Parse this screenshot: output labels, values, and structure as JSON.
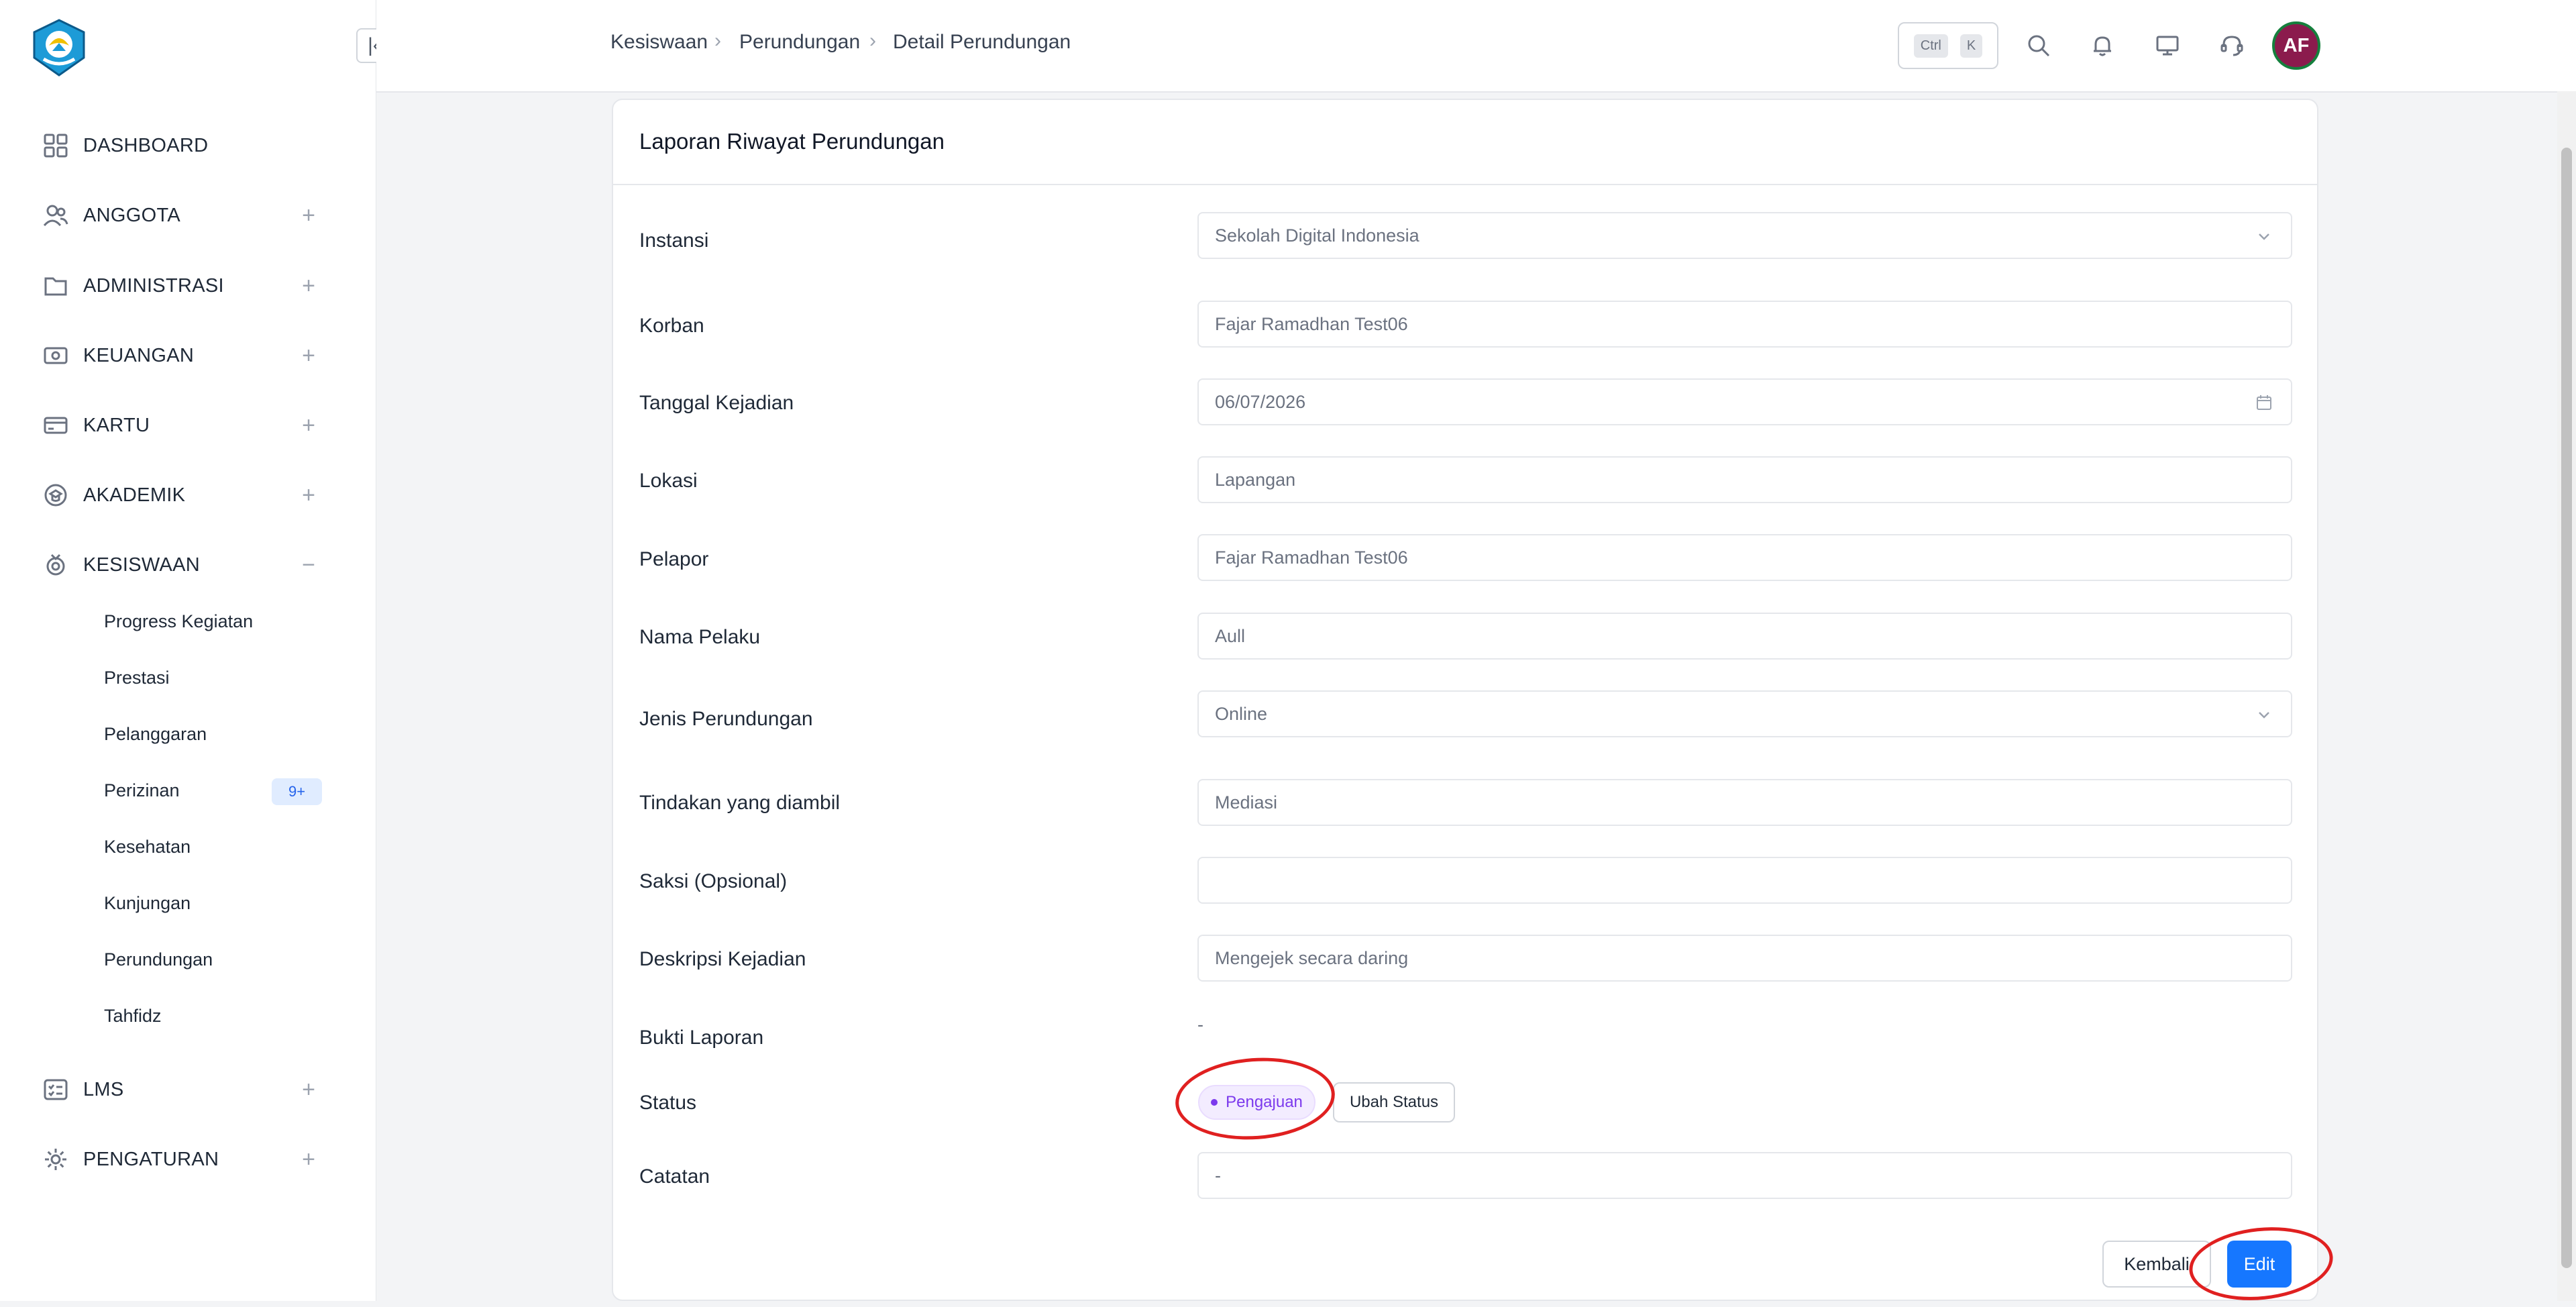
{
  "sidebar": {
    "items": [
      {
        "label": "DASHBOARD",
        "icon": "dashboard-grid-icon",
        "toggle": ""
      },
      {
        "label": "ANGGOTA",
        "icon": "users-icon",
        "toggle": "+"
      },
      {
        "label": "ADMINISTRASI",
        "icon": "folder-icon",
        "toggle": "+"
      },
      {
        "label": "KEUANGAN",
        "icon": "money-icon",
        "toggle": "+"
      },
      {
        "label": "KARTU",
        "icon": "card-icon",
        "toggle": "+"
      },
      {
        "label": "AKADEMIK",
        "icon": "academic-icon",
        "toggle": "+"
      },
      {
        "label": "KESISWAAN",
        "icon": "medal-icon",
        "toggle": "−"
      },
      {
        "label": "LMS",
        "icon": "list-check-icon",
        "toggle": "+"
      },
      {
        "label": "PENGATURAN",
        "icon": "gear-icon",
        "toggle": "+"
      }
    ],
    "subitems": [
      {
        "label": "Progress Kegiatan"
      },
      {
        "label": "Prestasi"
      },
      {
        "label": "Pelanggaran"
      },
      {
        "label": "Perizinan",
        "badge": "9+"
      },
      {
        "label": "Kesehatan"
      },
      {
        "label": "Kunjungan"
      },
      {
        "label": "Perundungan"
      },
      {
        "label": "Tahfidz"
      }
    ]
  },
  "header": {
    "breadcrumb": [
      "Kesiswaan",
      "Perundungan",
      "Detail Perundungan"
    ],
    "shortcut": {
      "key1": "Ctrl",
      "key2": "K"
    },
    "avatar_initials": "AF"
  },
  "card": {
    "title": "Laporan Riwayat Perundungan",
    "fields": [
      {
        "label": "Instansi",
        "value": "Sekolah Digital Indonesia"
      },
      {
        "label": "Korban",
        "value": "Fajar Ramadhan Test06"
      },
      {
        "label": "Tanggal Kejadian",
        "value": "06/07/2026"
      },
      {
        "label": "Lokasi",
        "value": "Lapangan"
      },
      {
        "label": "Pelapor",
        "value": "Fajar Ramadhan Test06"
      },
      {
        "label": "Nama Pelaku",
        "value": "Aull"
      },
      {
        "label": "Jenis Perundungan",
        "value": "Online"
      },
      {
        "label": "Tindakan yang diambil",
        "value": "Mediasi"
      },
      {
        "label": "Saksi (Opsional)",
        "value": ""
      },
      {
        "label": "Deskripsi Kejadian",
        "value": "Mengejek secara daring"
      },
      {
        "label": "Bukti Laporan",
        "value": "-"
      },
      {
        "label": "Status",
        "value": "Pengajuan"
      },
      {
        "label": "Catatan",
        "value": "-"
      }
    ],
    "status_action": "Ubah Status",
    "buttons": {
      "back": "Kembali",
      "edit": "Edit"
    }
  },
  "colors": {
    "primary": "#1677ff",
    "status_purple": "#7c3aed",
    "annotation_red": "#e02020",
    "avatar_bg": "#8b1b4d"
  }
}
